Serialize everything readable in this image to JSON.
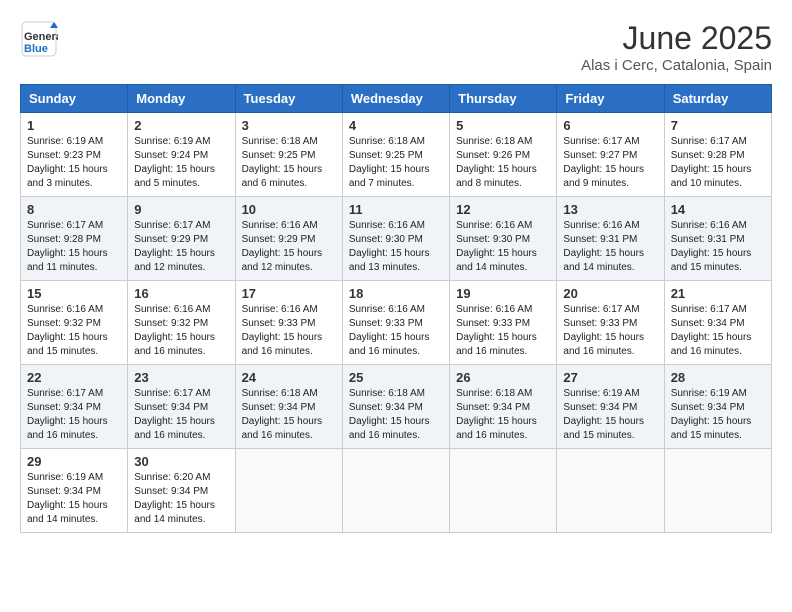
{
  "logo": {
    "line1": "General",
    "line2": "Blue"
  },
  "title": "June 2025",
  "subtitle": "Alas i Cerc, Catalonia, Spain",
  "headers": [
    "Sunday",
    "Monday",
    "Tuesday",
    "Wednesday",
    "Thursday",
    "Friday",
    "Saturday"
  ],
  "weeks": [
    [
      {
        "day": "1",
        "sunrise": "6:19 AM",
        "sunset": "9:23 PM",
        "daylight": "15 hours and 3 minutes."
      },
      {
        "day": "2",
        "sunrise": "6:19 AM",
        "sunset": "9:24 PM",
        "daylight": "15 hours and 5 minutes."
      },
      {
        "day": "3",
        "sunrise": "6:18 AM",
        "sunset": "9:25 PM",
        "daylight": "15 hours and 6 minutes."
      },
      {
        "day": "4",
        "sunrise": "6:18 AM",
        "sunset": "9:25 PM",
        "daylight": "15 hours and 7 minutes."
      },
      {
        "day": "5",
        "sunrise": "6:18 AM",
        "sunset": "9:26 PM",
        "daylight": "15 hours and 8 minutes."
      },
      {
        "day": "6",
        "sunrise": "6:17 AM",
        "sunset": "9:27 PM",
        "daylight": "15 hours and 9 minutes."
      },
      {
        "day": "7",
        "sunrise": "6:17 AM",
        "sunset": "9:28 PM",
        "daylight": "15 hours and 10 minutes."
      }
    ],
    [
      {
        "day": "8",
        "sunrise": "6:17 AM",
        "sunset": "9:28 PM",
        "daylight": "15 hours and 11 minutes."
      },
      {
        "day": "9",
        "sunrise": "6:17 AM",
        "sunset": "9:29 PM",
        "daylight": "15 hours and 12 minutes."
      },
      {
        "day": "10",
        "sunrise": "6:16 AM",
        "sunset": "9:29 PM",
        "daylight": "15 hours and 12 minutes."
      },
      {
        "day": "11",
        "sunrise": "6:16 AM",
        "sunset": "9:30 PM",
        "daylight": "15 hours and 13 minutes."
      },
      {
        "day": "12",
        "sunrise": "6:16 AM",
        "sunset": "9:30 PM",
        "daylight": "15 hours and 14 minutes."
      },
      {
        "day": "13",
        "sunrise": "6:16 AM",
        "sunset": "9:31 PM",
        "daylight": "15 hours and 14 minutes."
      },
      {
        "day": "14",
        "sunrise": "6:16 AM",
        "sunset": "9:31 PM",
        "daylight": "15 hours and 15 minutes."
      }
    ],
    [
      {
        "day": "15",
        "sunrise": "6:16 AM",
        "sunset": "9:32 PM",
        "daylight": "15 hours and 15 minutes."
      },
      {
        "day": "16",
        "sunrise": "6:16 AM",
        "sunset": "9:32 PM",
        "daylight": "15 hours and 16 minutes."
      },
      {
        "day": "17",
        "sunrise": "6:16 AM",
        "sunset": "9:33 PM",
        "daylight": "15 hours and 16 minutes."
      },
      {
        "day": "18",
        "sunrise": "6:16 AM",
        "sunset": "9:33 PM",
        "daylight": "15 hours and 16 minutes."
      },
      {
        "day": "19",
        "sunrise": "6:16 AM",
        "sunset": "9:33 PM",
        "daylight": "15 hours and 16 minutes."
      },
      {
        "day": "20",
        "sunrise": "6:17 AM",
        "sunset": "9:33 PM",
        "daylight": "15 hours and 16 minutes."
      },
      {
        "day": "21",
        "sunrise": "6:17 AM",
        "sunset": "9:34 PM",
        "daylight": "15 hours and 16 minutes."
      }
    ],
    [
      {
        "day": "22",
        "sunrise": "6:17 AM",
        "sunset": "9:34 PM",
        "daylight": "15 hours and 16 minutes."
      },
      {
        "day": "23",
        "sunrise": "6:17 AM",
        "sunset": "9:34 PM",
        "daylight": "15 hours and 16 minutes."
      },
      {
        "day": "24",
        "sunrise": "6:18 AM",
        "sunset": "9:34 PM",
        "daylight": "15 hours and 16 minutes."
      },
      {
        "day": "25",
        "sunrise": "6:18 AM",
        "sunset": "9:34 PM",
        "daylight": "15 hours and 16 minutes."
      },
      {
        "day": "26",
        "sunrise": "6:18 AM",
        "sunset": "9:34 PM",
        "daylight": "15 hours and 16 minutes."
      },
      {
        "day": "27",
        "sunrise": "6:19 AM",
        "sunset": "9:34 PM",
        "daylight": "15 hours and 15 minutes."
      },
      {
        "day": "28",
        "sunrise": "6:19 AM",
        "sunset": "9:34 PM",
        "daylight": "15 hours and 15 minutes."
      }
    ],
    [
      {
        "day": "29",
        "sunrise": "6:19 AM",
        "sunset": "9:34 PM",
        "daylight": "15 hours and 14 minutes."
      },
      {
        "day": "30",
        "sunrise": "6:20 AM",
        "sunset": "9:34 PM",
        "daylight": "15 hours and 14 minutes."
      },
      null,
      null,
      null,
      null,
      null
    ]
  ],
  "labels": {
    "sunrise": "Sunrise:",
    "sunset": "Sunset:",
    "daylight": "Daylight:"
  }
}
